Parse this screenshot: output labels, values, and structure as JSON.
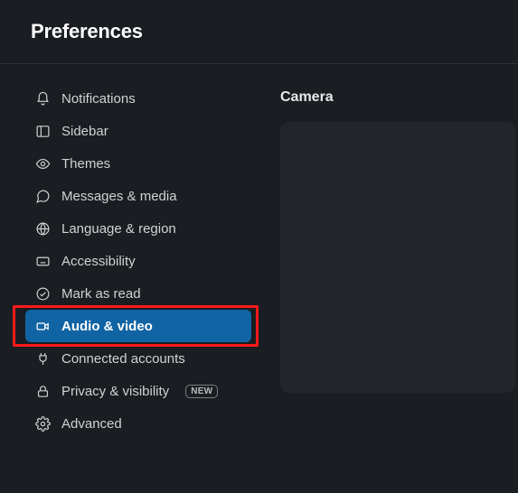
{
  "header": {
    "title": "Preferences"
  },
  "sidebar": {
    "items": [
      {
        "label": "Notifications"
      },
      {
        "label": "Sidebar"
      },
      {
        "label": "Themes"
      },
      {
        "label": "Messages & media"
      },
      {
        "label": "Language & region"
      },
      {
        "label": "Accessibility"
      },
      {
        "label": "Mark as read"
      },
      {
        "label": "Audio & video"
      },
      {
        "label": "Connected accounts"
      },
      {
        "label": "Privacy & visibility",
        "badge": "NEW"
      },
      {
        "label": "Advanced"
      }
    ]
  },
  "main": {
    "section_title": "Camera"
  },
  "colors": {
    "active_bg": "#1164a3",
    "highlight_border": "#ff1a1a"
  }
}
